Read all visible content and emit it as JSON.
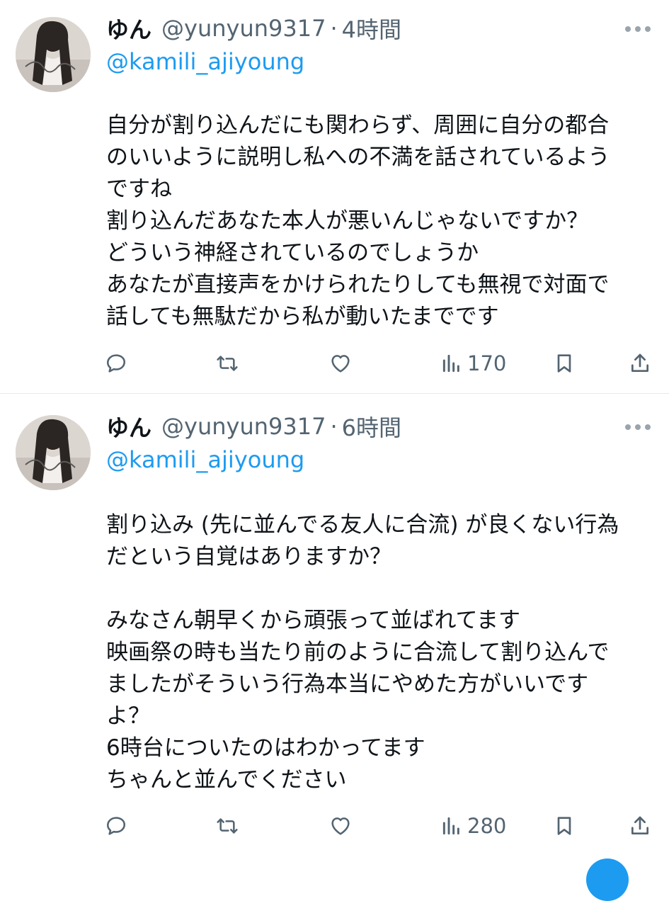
{
  "tweets": [
    {
      "display_name": "ゆん",
      "handle": "@yunyun9317",
      "separator": "·",
      "time": "4時間",
      "reply_to": "@kamili_ajiyoung",
      "lines": [
        "自分が割り込んだにも関わらず、周囲に自分の都合",
        "のいいように説明し私への不満を話されているよう",
        "ですね",
        "割り込んだあなた本人が悪いんじゃないですか？",
        "どういう神経されているのでしょうか",
        "あなたが直接声をかけられたりしても無視で対面で",
        "話しても無駄だから私が動いたまでです"
      ],
      "views": "170"
    },
    {
      "display_name": "ゆん",
      "handle": "@yunyun9317",
      "separator": "·",
      "time": "6時間",
      "reply_to": "@kamili_ajiyoung",
      "lines": [
        "割り込み (先に並んでる友人に合流) が良くない行為",
        "だという自覚はありますか？",
        "",
        "みなさん朝早くから頑張って並ばれてます",
        "映画祭の時も当たり前のように合流して割り込んで",
        "ましたがそういう行為本当にやめた方がいいです",
        "よ？",
        "6時台についたのはわかってます",
        "ちゃんと並んでください"
      ],
      "views": "280"
    }
  ],
  "icons": {
    "reply": "reply-icon",
    "retweet": "retweet-icon",
    "like": "heart-icon",
    "views": "views-chart-icon",
    "bookmark": "bookmark-icon",
    "share": "share-icon",
    "more": "more-dots-icon"
  },
  "colors": {
    "text": "#0f1419",
    "muted": "#536471",
    "link": "#1d9bf0",
    "divider": "#e6e9eb"
  }
}
